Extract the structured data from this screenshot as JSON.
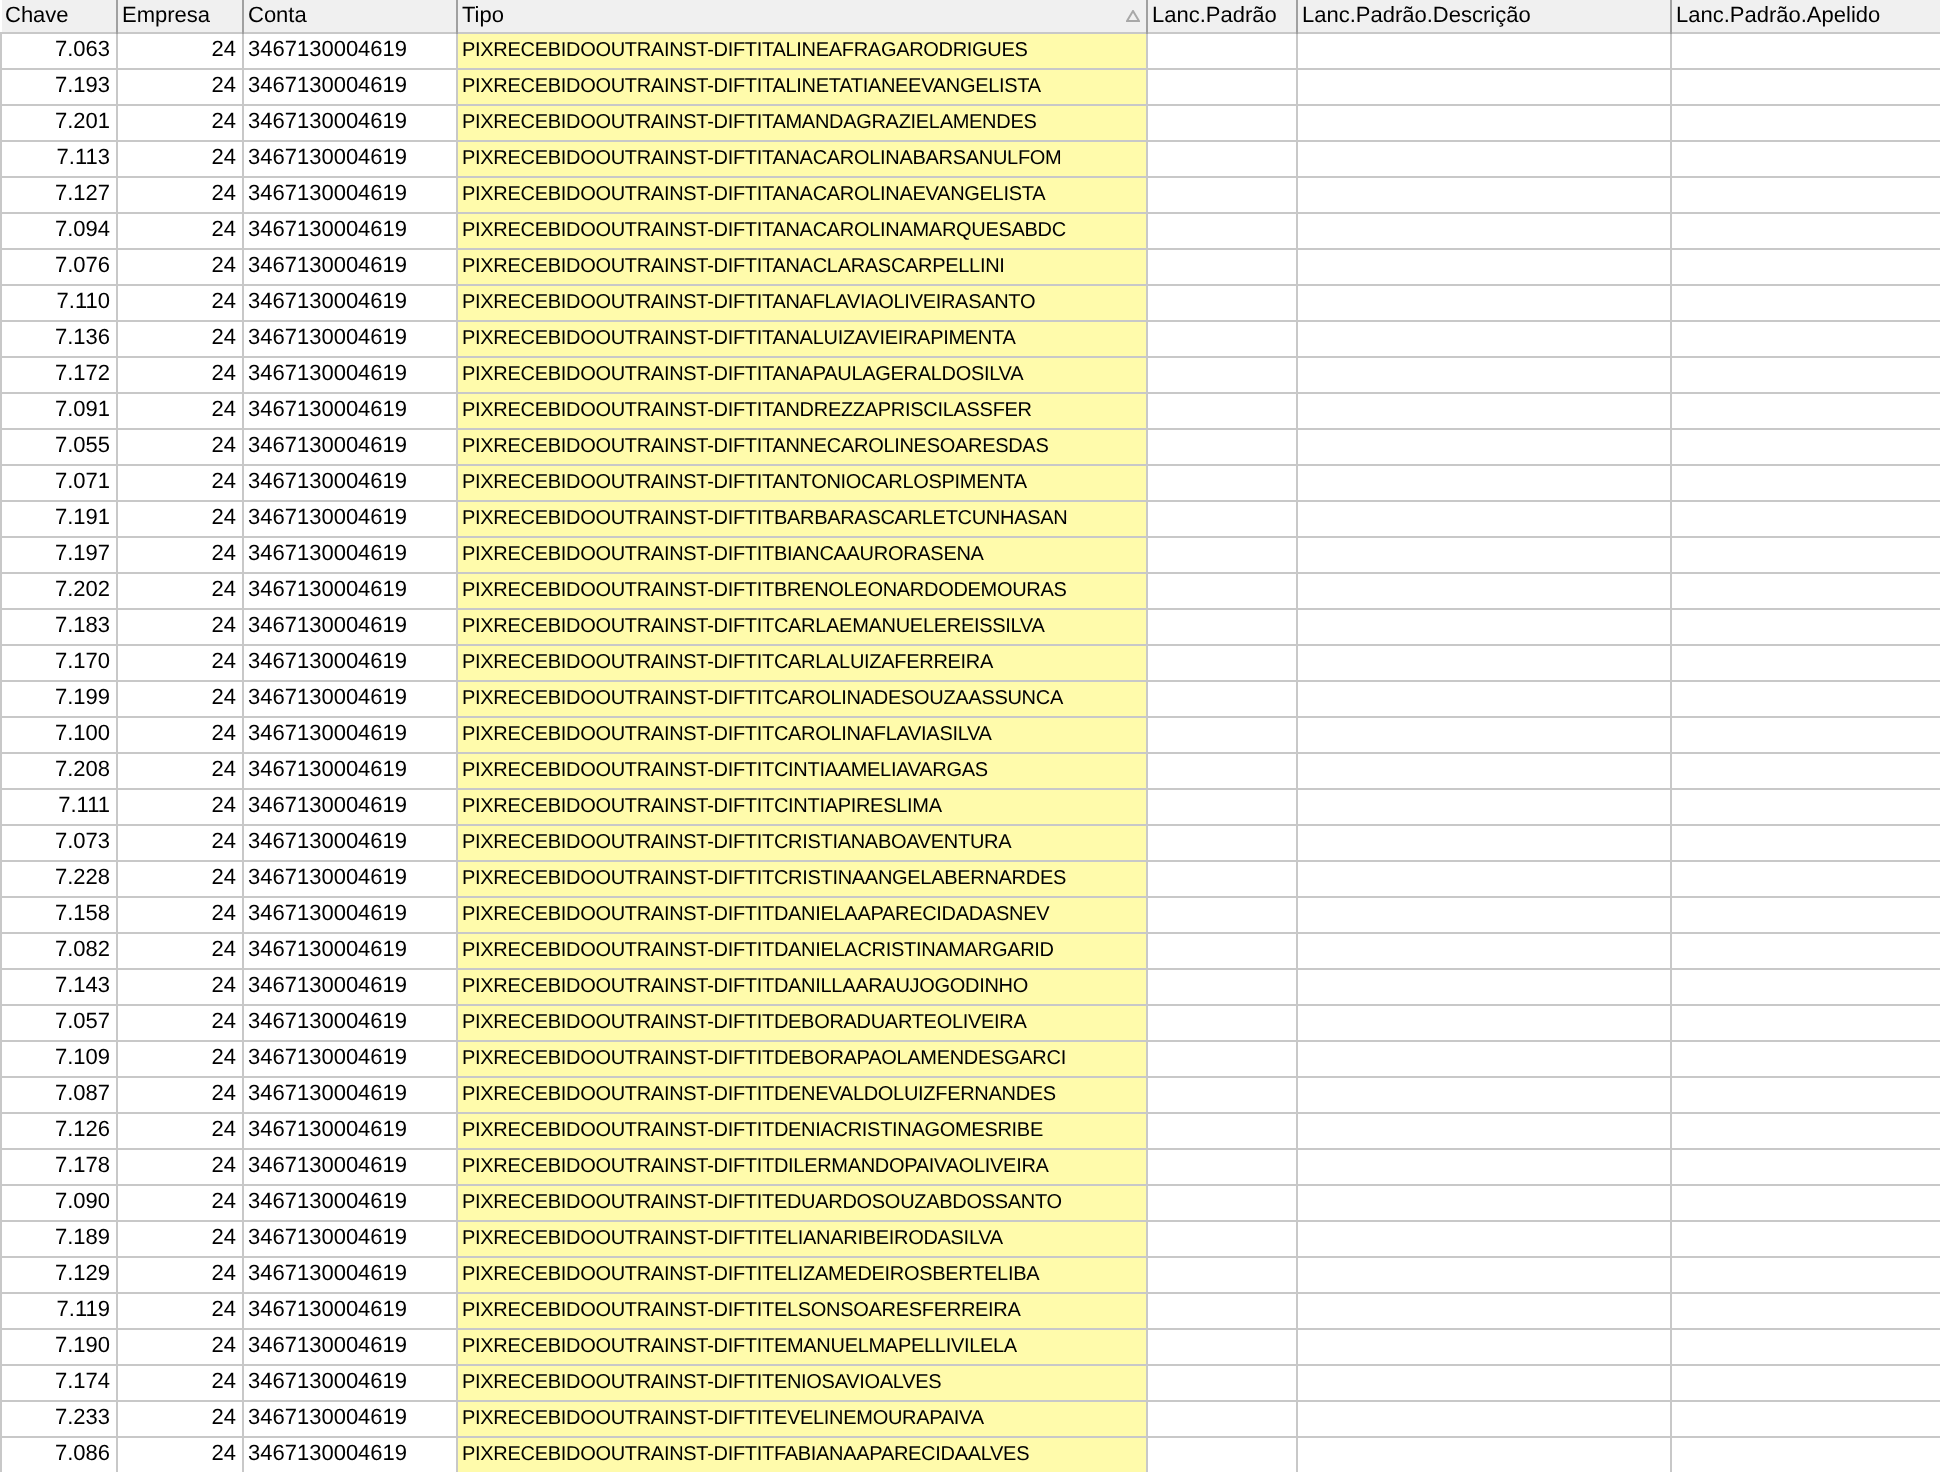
{
  "table": {
    "columns": [
      {
        "label": "Chave",
        "sorted": false
      },
      {
        "label": "Empresa",
        "sorted": false
      },
      {
        "label": "Conta",
        "sorted": false
      },
      {
        "label": "Tipo",
        "sorted": true
      },
      {
        "label": "Lanc.Padrão",
        "sorted": false
      },
      {
        "label": "Lanc.Padrão.Descrição",
        "sorted": false
      },
      {
        "label": "Lanc.Padrão.Apelido",
        "sorted": false
      }
    ],
    "rows": [
      [
        "7.063",
        "24",
        "3467130004619",
        "PIXRECEBIDOOUTRAINST-DIFTITALINEAFRAGARODRIGUES"
      ],
      [
        "7.193",
        "24",
        "3467130004619",
        "PIXRECEBIDOOUTRAINST-DIFTITALINETATIANEEVANGELISTA"
      ],
      [
        "7.201",
        "24",
        "3467130004619",
        "PIXRECEBIDOOUTRAINST-DIFTITAMANDAGRAZIELAMENDES"
      ],
      [
        "7.113",
        "24",
        "3467130004619",
        "PIXRECEBIDOOUTRAINST-DIFTITANACAROLINABARSANULFOM"
      ],
      [
        "7.127",
        "24",
        "3467130004619",
        "PIXRECEBIDOOUTRAINST-DIFTITANACAROLINAEVANGELISTA"
      ],
      [
        "7.094",
        "24",
        "3467130004619",
        "PIXRECEBIDOOUTRAINST-DIFTITANACAROLINAMARQUESABDC"
      ],
      [
        "7.076",
        "24",
        "3467130004619",
        "PIXRECEBIDOOUTRAINST-DIFTITANACLARASCARPELLINI"
      ],
      [
        "7.110",
        "24",
        "3467130004619",
        "PIXRECEBIDOOUTRAINST-DIFTITANAFLAVIAOLIVEIRASANTO"
      ],
      [
        "7.136",
        "24",
        "3467130004619",
        "PIXRECEBIDOOUTRAINST-DIFTITANALUIZAVIEIRAPIMENTA"
      ],
      [
        "7.172",
        "24",
        "3467130004619",
        "PIXRECEBIDOOUTRAINST-DIFTITANAPAULAGERALDOSILVA"
      ],
      [
        "7.091",
        "24",
        "3467130004619",
        "PIXRECEBIDOOUTRAINST-DIFTITANDREZZAPRISCILASSFER"
      ],
      [
        "7.055",
        "24",
        "3467130004619",
        "PIXRECEBIDOOUTRAINST-DIFTITANNECAROLINESOARESDAS"
      ],
      [
        "7.071",
        "24",
        "3467130004619",
        "PIXRECEBIDOOUTRAINST-DIFTITANTONIOCARLOSPIMENTA"
      ],
      [
        "7.191",
        "24",
        "3467130004619",
        "PIXRECEBIDOOUTRAINST-DIFTITBARBARASCARLETCUNHASAN"
      ],
      [
        "7.197",
        "24",
        "3467130004619",
        "PIXRECEBIDOOUTRAINST-DIFTITBIANCAAURORASENA"
      ],
      [
        "7.202",
        "24",
        "3467130004619",
        "PIXRECEBIDOOUTRAINST-DIFTITBRENOLEONARDODEMOURAS"
      ],
      [
        "7.183",
        "24",
        "3467130004619",
        "PIXRECEBIDOOUTRAINST-DIFTITCARLAEMANUELEREISSILVA"
      ],
      [
        "7.170",
        "24",
        "3467130004619",
        "PIXRECEBIDOOUTRAINST-DIFTITCARLALUIZAFERREIRA"
      ],
      [
        "7.199",
        "24",
        "3467130004619",
        "PIXRECEBIDOOUTRAINST-DIFTITCAROLINADESOUZAASSUNCA"
      ],
      [
        "7.100",
        "24",
        "3467130004619",
        "PIXRECEBIDOOUTRAINST-DIFTITCAROLINAFLAVIASILVA"
      ],
      [
        "7.208",
        "24",
        "3467130004619",
        "PIXRECEBIDOOUTRAINST-DIFTITCINTIAAMELIAVARGAS"
      ],
      [
        "7.111",
        "24",
        "3467130004619",
        "PIXRECEBIDOOUTRAINST-DIFTITCINTIAPIRESLIMA"
      ],
      [
        "7.073",
        "24",
        "3467130004619",
        "PIXRECEBIDOOUTRAINST-DIFTITCRISTIANABOAVENTURA"
      ],
      [
        "7.228",
        "24",
        "3467130004619",
        "PIXRECEBIDOOUTRAINST-DIFTITCRISTINAANGELABERNARDES"
      ],
      [
        "7.158",
        "24",
        "3467130004619",
        "PIXRECEBIDOOUTRAINST-DIFTITDANIELAAPARECIDADASNEV"
      ],
      [
        "7.082",
        "24",
        "3467130004619",
        "PIXRECEBIDOOUTRAINST-DIFTITDANIELACRISTINAMARGARID"
      ],
      [
        "7.143",
        "24",
        "3467130004619",
        "PIXRECEBIDOOUTRAINST-DIFTITDANILLAARAUJOGODINHO"
      ],
      [
        "7.057",
        "24",
        "3467130004619",
        "PIXRECEBIDOOUTRAINST-DIFTITDEBORADUARTEOLIVEIRA"
      ],
      [
        "7.109",
        "24",
        "3467130004619",
        "PIXRECEBIDOOUTRAINST-DIFTITDEBORAPAOLAMENDESGARCI"
      ],
      [
        "7.087",
        "24",
        "3467130004619",
        "PIXRECEBIDOOUTRAINST-DIFTITDENEVALDOLUIZFERNANDES"
      ],
      [
        "7.126",
        "24",
        "3467130004619",
        "PIXRECEBIDOOUTRAINST-DIFTITDENIACRISTINAGOMESRIBE"
      ],
      [
        "7.178",
        "24",
        "3467130004619",
        "PIXRECEBIDOOUTRAINST-DIFTITDILERMANDOPAIVAOLIVEIRA"
      ],
      [
        "7.090",
        "24",
        "3467130004619",
        "PIXRECEBIDOOUTRAINST-DIFTITEDUARDOSOUZABDOSSANTO"
      ],
      [
        "7.189",
        "24",
        "3467130004619",
        "PIXRECEBIDOOUTRAINST-DIFTITELIANARIBEIRODASILVA"
      ],
      [
        "7.129",
        "24",
        "3467130004619",
        "PIXRECEBIDOOUTRAINST-DIFTITELIZAMEDEIROSBERTELIBA"
      ],
      [
        "7.119",
        "24",
        "3467130004619",
        "PIXRECEBIDOOUTRAINST-DIFTITELSONSOARESFERREIRA"
      ],
      [
        "7.190",
        "24",
        "3467130004619",
        "PIXRECEBIDOOUTRAINST-DIFTITEMANUELMAPELLIVILELA"
      ],
      [
        "7.174",
        "24",
        "3467130004619",
        "PIXRECEBIDOOUTRAINST-DIFTITENIOSAVIOALVES"
      ],
      [
        "7.233",
        "24",
        "3467130004619",
        "PIXRECEBIDOOUTRAINST-DIFTITEVELINEMOURAPAIVA"
      ],
      [
        "7.086",
        "24",
        "3467130004619",
        "PIXRECEBIDOOUTRAINST-DIFTITFABIANAAPARECIDAALVES"
      ]
    ]
  }
}
